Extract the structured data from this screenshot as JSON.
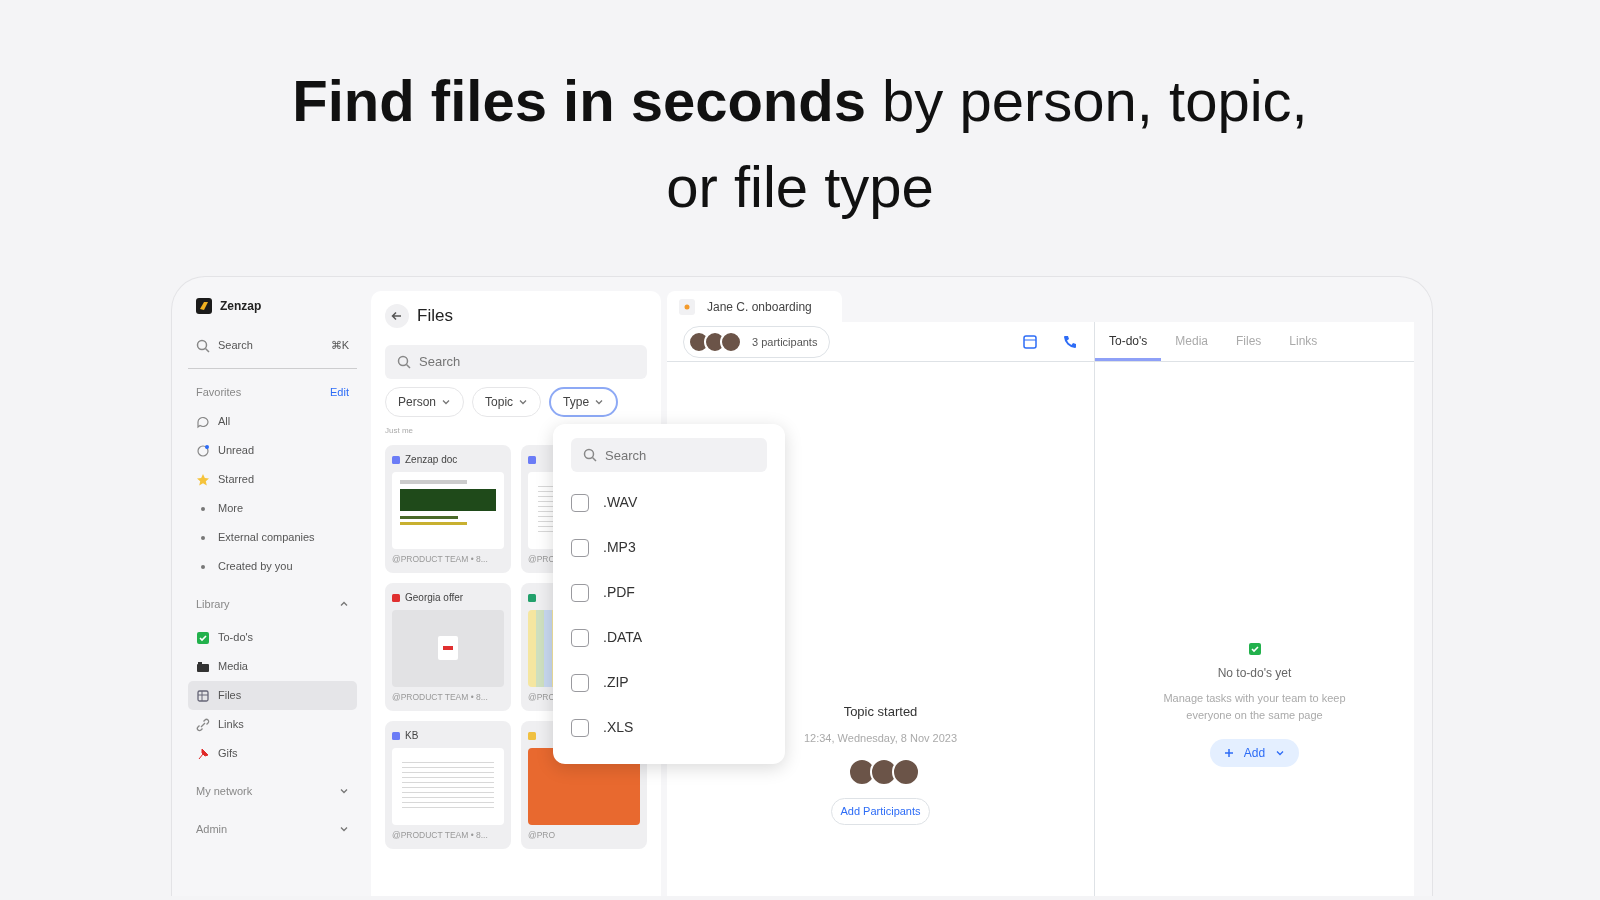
{
  "headline": "**Find files in seconds** by person, topic, or file type",
  "sidebar": {
    "brand": "Zenzap",
    "search": {
      "label": "Search",
      "shortcut": "⌘K"
    },
    "favorites": {
      "title": "Favorites",
      "action": "Edit",
      "items": [
        {
          "label": "All",
          "kind": "icon",
          "selected": false
        },
        {
          "label": "Unread",
          "kind": "icon",
          "selected": false
        },
        {
          "label": "Starred",
          "kind": "icon",
          "selected": false
        },
        {
          "label": "More",
          "kind": "bullet",
          "selected": false
        },
        {
          "label": "External companies",
          "kind": "bullet",
          "selected": false
        },
        {
          "label": "Created by you",
          "kind": "bullet",
          "selected": false
        }
      ]
    },
    "sections": [
      {
        "title": "Library",
        "expanded": true,
        "items": [
          {
            "label": "To-do's",
            "selected": false
          },
          {
            "label": "Media",
            "selected": false
          },
          {
            "label": "Files",
            "selected": true
          },
          {
            "label": "Links",
            "selected": false
          },
          {
            "label": "Gifs",
            "selected": false
          }
        ]
      },
      {
        "title": "My network",
        "expanded": false
      },
      {
        "title": "Admin",
        "expanded": false
      }
    ]
  },
  "files_panel": {
    "title": "Files",
    "search": {
      "placeholder": "Search"
    },
    "filters": [
      {
        "label": "Person",
        "selected": false
      },
      {
        "label": "Topic",
        "selected": false
      },
      {
        "label": "Type",
        "selected": true
      }
    ],
    "section_label": "Just me",
    "cards": [
      {
        "kind": "doc",
        "title": "Zenzap doc",
        "caption": "@PRODUCT TEAM • 8..."
      },
      {
        "kind": "page",
        "caption": "@PRO"
      },
      {
        "kind": "pdf",
        "title": "Georgia offer",
        "caption": "@PRODUCT TEAM • 8..."
      },
      {
        "kind": "sheet",
        "caption": "@PRO"
      },
      {
        "kind": "page",
        "title": "KB",
        "caption": "@PRODUCT TEAM • 8..."
      },
      {
        "kind": "slides",
        "caption": "@PRO"
      }
    ],
    "type_menu": {
      "search": {
        "placeholder": "Search"
      },
      "options": [
        {
          "label": ".WAV",
          "checked": false
        },
        {
          "label": ".MP3",
          "checked": false
        },
        {
          "label": ".PDF",
          "checked": false
        },
        {
          "label": ".DATA",
          "checked": false
        },
        {
          "label": ".ZIP",
          "checked": false
        },
        {
          "label": ".XLS",
          "checked": false
        }
      ]
    }
  },
  "chat": {
    "tab": "Jane C. onboarding",
    "participants": "3 participants",
    "event": {
      "title": "Topic started",
      "time": "12:34, Wednesday, 8 Nov 2023",
      "action": "Add Participants"
    }
  },
  "details": {
    "tabs": [
      {
        "label": "To-do's",
        "selected": true
      },
      {
        "label": "Media",
        "selected": false
      },
      {
        "label": "Files",
        "selected": false
      },
      {
        "label": "Links",
        "selected": false
      }
    ],
    "empty": {
      "title": "No to-do's yet",
      "text": "Manage tasks with your team to keep everyone on the same page",
      "action": "Add"
    }
  }
}
